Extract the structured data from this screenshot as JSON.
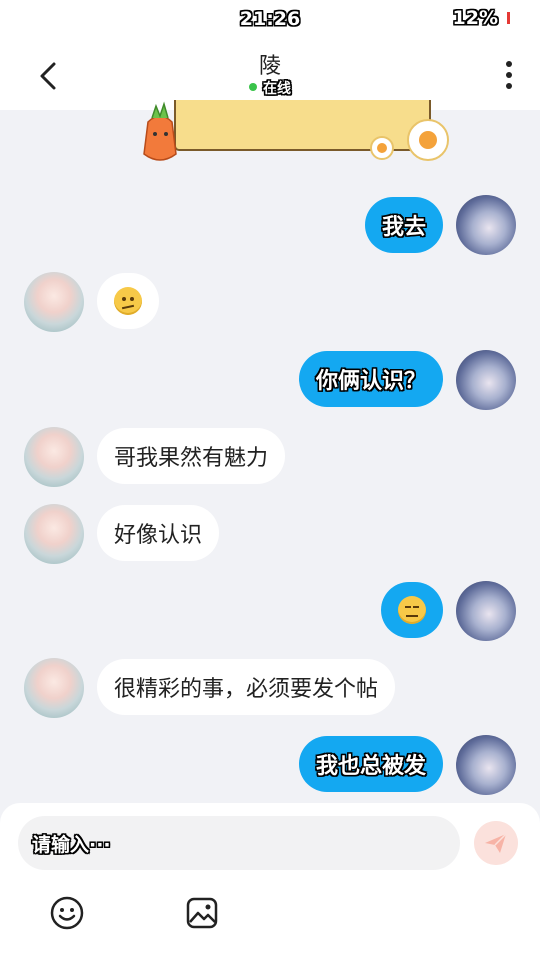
{
  "status_bar": {
    "time": "21:26",
    "battery": "12%"
  },
  "header": {
    "title": "陵",
    "status": "在线"
  },
  "icons": {
    "back": "back-arrow-icon",
    "more": "more-vertical-icon",
    "emoji_tool": "emoji-icon",
    "image_tool": "image-icon",
    "send": "send-icon",
    "sticker": "carrot-sticker",
    "confused_emoji": "confused-face-emoji",
    "expressionless_emoji": "expressionless-face-emoji"
  },
  "messages": [
    {
      "from": "me",
      "text": "我去"
    },
    {
      "from": "other",
      "emoji": "confused-face-emoji"
    },
    {
      "from": "me",
      "text": "你俩认识？"
    },
    {
      "from": "other",
      "text": "哥我果然有魅力"
    },
    {
      "from": "other",
      "text": "好像认识"
    },
    {
      "from": "me",
      "emoji": "expressionless-face-emoji"
    },
    {
      "from": "other",
      "text": "很精彩的事，必须要发个帖"
    },
    {
      "from": "me",
      "text": "我也总被发"
    }
  ],
  "composer": {
    "placeholder": "请输入···"
  },
  "colors": {
    "outgoing_bubble": "#14a8f1",
    "incoming_bubble": "#ffffff",
    "online": "#3ac34a",
    "background": "#f1f2f6"
  }
}
